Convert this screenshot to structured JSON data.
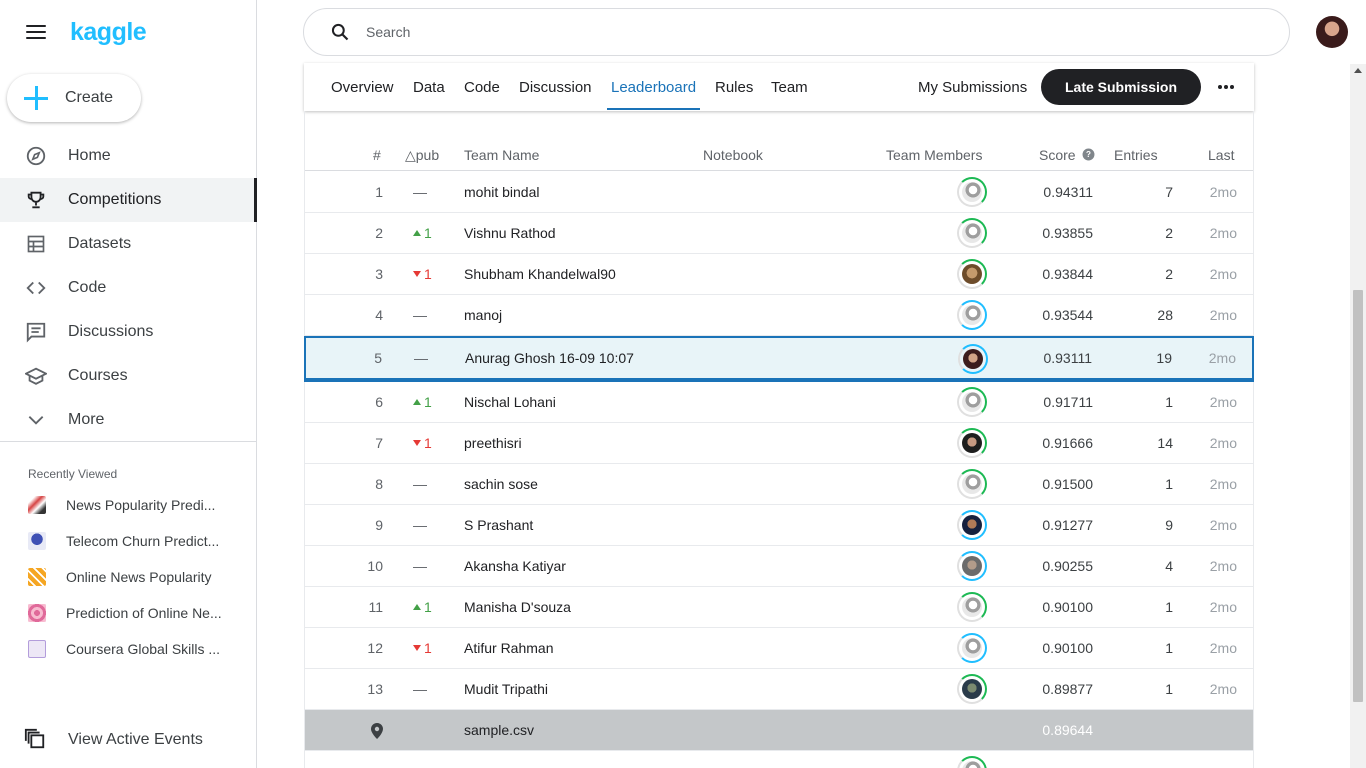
{
  "sidebar": {
    "logo": "kaggle",
    "create_label": "Create",
    "nav": [
      {
        "label": "Home",
        "icon": "compass-icon"
      },
      {
        "label": "Competitions",
        "icon": "trophy-icon",
        "active": true
      },
      {
        "label": "Datasets",
        "icon": "table-icon"
      },
      {
        "label": "Code",
        "icon": "code-icon"
      },
      {
        "label": "Discussions",
        "icon": "discussion-icon"
      },
      {
        "label": "Courses",
        "icon": "school-icon"
      },
      {
        "label": "More",
        "icon": "chevron-down-icon"
      }
    ],
    "recently_viewed_title": "Recently Viewed",
    "recent": [
      {
        "label": "News Popularity Predi...",
        "color": "#d64545"
      },
      {
        "label": "Telecom Churn Predict...",
        "color": "#3f51b5"
      },
      {
        "label": "Online News Popularity",
        "color": "#f5a623"
      },
      {
        "label": "Prediction of Online Ne...",
        "color": "#e06a9a"
      },
      {
        "label": "Coursera Global Skills ...",
        "color": "#b39ddb"
      }
    ],
    "view_events": "View Active Events"
  },
  "search": {
    "placeholder": "Search"
  },
  "tabs": {
    "items": [
      "Overview",
      "Data",
      "Code",
      "Discussion",
      "Leaderboard",
      "Rules",
      "Team"
    ],
    "active": "Leaderboard",
    "my_submissions": "My Submissions",
    "late_submission": "Late Submission"
  },
  "leaderboard": {
    "headers": {
      "rank": "#",
      "delta": "△pub",
      "team": "Team Name",
      "notebook": "Notebook",
      "members": "Team Members",
      "score": "Score",
      "entries": "Entries",
      "last": "Last"
    },
    "rows": [
      {
        "rank": "1",
        "delta": "—",
        "dir": "none",
        "team": "mohit bindal",
        "face": "default",
        "ring": "green",
        "score": "0.94311",
        "entries": "7",
        "last": "2mo"
      },
      {
        "rank": "2",
        "delta": "1",
        "dir": "up",
        "team": "Vishnu Rathod",
        "face": "default",
        "ring": "green",
        "score": "0.93855",
        "entries": "2",
        "last": "2mo"
      },
      {
        "rank": "3",
        "delta": "1",
        "dir": "down",
        "team": "Shubham Khandelwal90",
        "face": "photo1",
        "ring": "green",
        "score": "0.93844",
        "entries": "2",
        "last": "2mo"
      },
      {
        "rank": "4",
        "delta": "—",
        "dir": "none",
        "team": "manoj",
        "face": "default",
        "ring": "blue",
        "score": "0.93544",
        "entries": "28",
        "last": "2mo"
      },
      {
        "rank": "5",
        "delta": "—",
        "dir": "none",
        "team": "Anurag Ghosh 16-09 10:07",
        "face": "photo2",
        "ring": "blue",
        "score": "0.93111",
        "entries": "19",
        "last": "2mo",
        "me": true
      },
      {
        "rank": "6",
        "delta": "1",
        "dir": "up",
        "team": "Nischal Lohani",
        "face": "default",
        "ring": "green",
        "score": "0.91711",
        "entries": "1",
        "last": "2mo"
      },
      {
        "rank": "7",
        "delta": "1",
        "dir": "down",
        "team": "preethisri",
        "face": "photo3",
        "ring": "green",
        "score": "0.91666",
        "entries": "14",
        "last": "2mo"
      },
      {
        "rank": "8",
        "delta": "—",
        "dir": "none",
        "team": "sachin sose",
        "face": "default",
        "ring": "green",
        "score": "0.91500",
        "entries": "1",
        "last": "2mo"
      },
      {
        "rank": "9",
        "delta": "—",
        "dir": "none",
        "team": "S Prashant",
        "face": "photo4",
        "ring": "blue",
        "score": "0.91277",
        "entries": "9",
        "last": "2mo"
      },
      {
        "rank": "10",
        "delta": "—",
        "dir": "none",
        "team": "Akansha Katiyar",
        "face": "photo5",
        "ring": "blue",
        "score": "0.90255",
        "entries": "4",
        "last": "2mo"
      },
      {
        "rank": "11",
        "delta": "1",
        "dir": "up",
        "team": "Manisha D'souza",
        "face": "default",
        "ring": "green",
        "score": "0.90100",
        "entries": "1",
        "last": "2mo"
      },
      {
        "rank": "12",
        "delta": "1",
        "dir": "down",
        "team": "Atifur Rahman",
        "face": "default",
        "ring": "blue",
        "score": "0.90100",
        "entries": "1",
        "last": "2mo"
      },
      {
        "rank": "13",
        "delta": "—",
        "dir": "none",
        "team": "Mudit Tripathi",
        "face": "photo6",
        "ring": "green",
        "score": "0.89877",
        "entries": "1",
        "last": "2mo"
      }
    ],
    "benchmark": {
      "team": "sample.csv",
      "score": "0.89644"
    }
  }
}
